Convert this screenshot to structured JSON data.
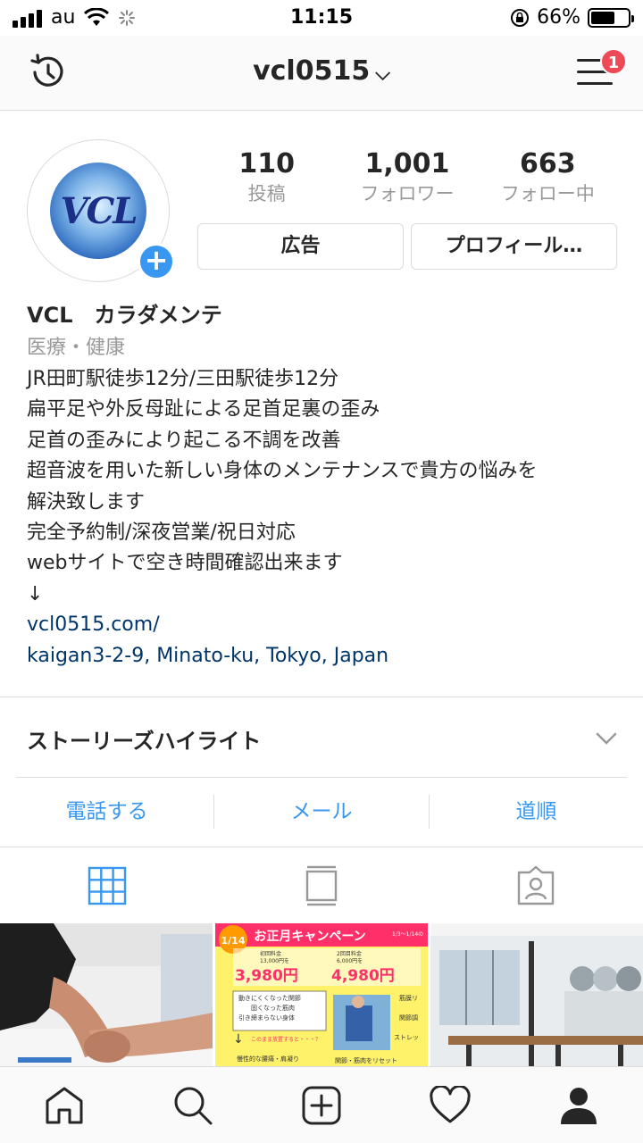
{
  "status_bar": {
    "carrier": "au",
    "time": "11:15",
    "battery": "66%",
    "battery_level": 0.66
  },
  "header": {
    "username": "vcl0515",
    "notification_count": "1"
  },
  "profile": {
    "avatar_text": "VCL",
    "stats": [
      {
        "value": "110",
        "label": "投稿"
      },
      {
        "value": "1,001",
        "label": "フォロワー"
      },
      {
        "value": "663",
        "label": "フォロー中"
      }
    ],
    "ad_button": "広告",
    "profile_button": "プロフィール…"
  },
  "bio": {
    "name": "VCL　カラダメンテ",
    "category": "医療・健康",
    "lines": [
      "JR田町駅徒歩12分/三田駅徒歩12分",
      "扁平足や外反母趾による足首足裏の歪み",
      "足首の歪みにより起こる不調を改善",
      "超音波を用いた新しい身体のメンテナンスで貴方の悩みを",
      "解決致します",
      "完全予約制/深夜営業/祝日対応",
      "webサイトで空き時間確認出来ます",
      "↓"
    ],
    "website": "vcl0515.com/",
    "address": "kaigan3-2-9, Minato-ku, Tokyo, Japan"
  },
  "highlights": {
    "title": "ストーリーズハイライト"
  },
  "actions": [
    {
      "label": "電話する"
    },
    {
      "label": "メール"
    },
    {
      "label": "道順"
    }
  ],
  "grid": {
    "post2": {
      "date": "1/14",
      "title": "お正月キャンペーン",
      "note": "1/3〜1/14の",
      "price1_label": "初回料金",
      "price1_old": "13,000円を",
      "price1": "3,980円",
      "price2_label": "2回目料金",
      "price2_old": "6,000円を",
      "price2": "4,980円",
      "text1": "動きにくくなった関節",
      "text2": "固くなった筋肉",
      "text3": "引き締まらない身体",
      "text4": "このまま放置すると・・・？",
      "text5": "慢性的な腰痛・肩凝り",
      "right1": "筋膜リ",
      "right2": "関節調",
      "right3": "ストレッ",
      "bottom": "関節・筋肉をリセット"
    }
  }
}
